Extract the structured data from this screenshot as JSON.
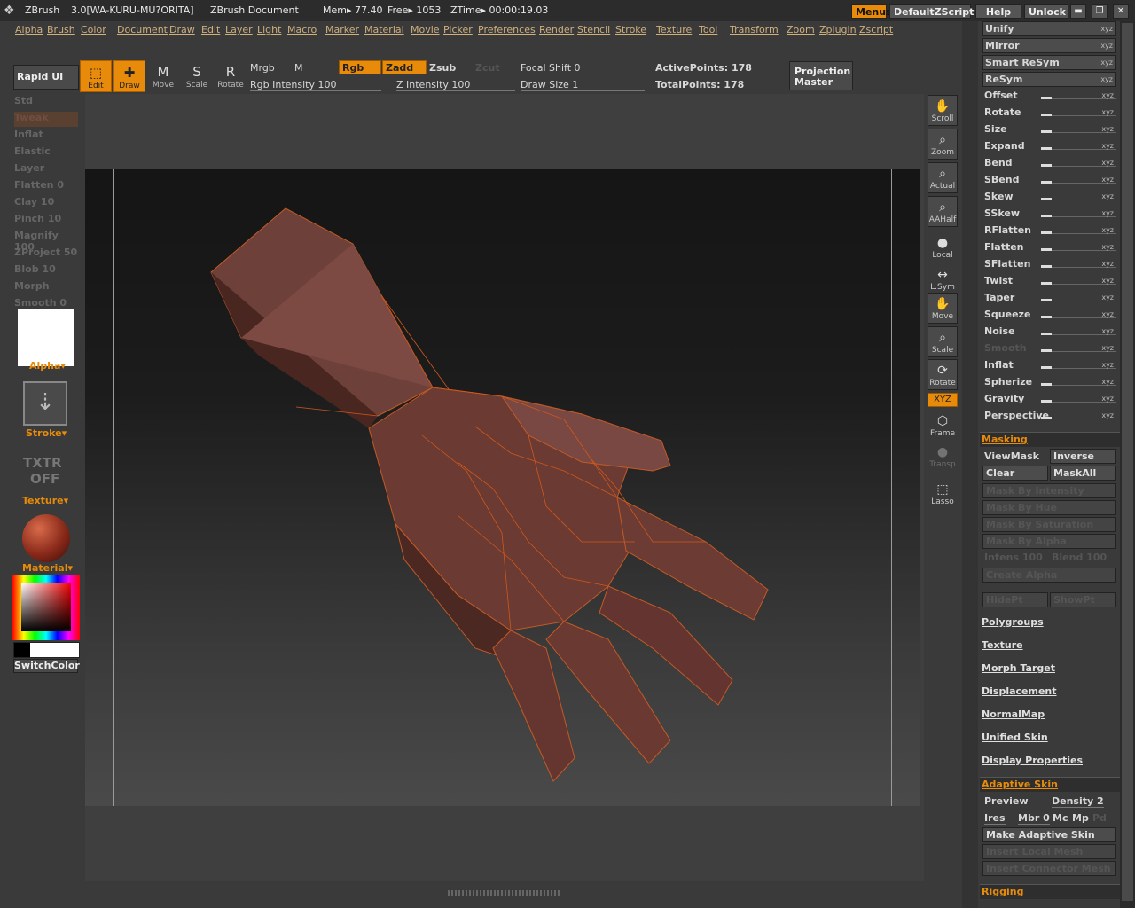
{
  "titlebar": {
    "app": "ZBrush",
    "version": "3.0[WA-KURU-MU?ORITA]",
    "document": "ZBrush Document",
    "mem": "Mem▸ 77.40",
    "free": "Free▸ 1053",
    "ztime": "ZTime▸ 00:00:19.03",
    "menus_btn": "Menus",
    "script_btn": "DefaultZScript",
    "help_btn": "Help",
    "unlock_btn": "Unlock"
  },
  "menubar": [
    "Alpha",
    "Brush",
    "Color",
    "Document",
    "Draw",
    "Edit",
    "Layer",
    "Light",
    "Macro",
    "Marker",
    "Material",
    "Movie",
    "Picker",
    "Preferences",
    "Render",
    "Stencil",
    "Stroke",
    "Texture",
    "Tool",
    "Transform",
    "Zoom",
    "Zplugin",
    "Zscript"
  ],
  "shelf": {
    "rapid_ui": "Rapid UI",
    "tools": [
      {
        "label": "Edit",
        "icon": "edit-icon",
        "glyph": "⬚",
        "active": true
      },
      {
        "label": "Draw",
        "icon": "draw-icon",
        "glyph": "✚",
        "active": true
      },
      {
        "label": "Move",
        "icon": "move-icon",
        "glyph": "M",
        "active": false
      },
      {
        "label": "Scale",
        "icon": "scale-icon",
        "glyph": "S",
        "active": false
      },
      {
        "label": "Rotate",
        "icon": "rotate-icon",
        "glyph": "R",
        "active": false
      }
    ],
    "mrgb": "Mrgb",
    "m": "M",
    "rgb": "Rgb",
    "zadd": "Zadd",
    "zsub": "Zsub",
    "zcut": "Zcut",
    "rgb_intensity": "Rgb  Intensity 100",
    "z_intensity": "Z  Intensity 100",
    "focal_shift": "Focal  Shift 0",
    "draw_size": "Draw  Size 1",
    "active_points": "ActivePoints: 178",
    "total_points": "TotalPoints: 178",
    "projection_master": [
      "Projection",
      "Master"
    ]
  },
  "left_tray": {
    "brushes": [
      {
        "label": "Std",
        "active": false
      },
      {
        "label": "Tweak",
        "active": true
      },
      {
        "label": "Inflat",
        "active": false
      },
      {
        "label": "Elastic",
        "active": false
      },
      {
        "label": "Layer",
        "active": false
      },
      {
        "label": "Flatten 0",
        "active": false
      },
      {
        "label": "Clay 10",
        "active": false
      },
      {
        "label": "Pinch 10",
        "active": false
      },
      {
        "label": "Magnify 100",
        "active": false
      },
      {
        "label": "ZProject 50",
        "active": false
      },
      {
        "label": "Blob 10",
        "active": false
      },
      {
        "label": "Morph",
        "active": false
      },
      {
        "label": "Smooth 0",
        "active": false
      }
    ],
    "alpha": "Alpha▾",
    "stroke": "Stroke▾",
    "texture_off": [
      "TXTR",
      "OFF"
    ],
    "texture": "Texture▾",
    "material": "Material▾",
    "switch_color": "SwitchColor"
  },
  "right_tools": [
    {
      "label": "Scroll",
      "icon": "scroll-hand-icon",
      "glyph": "✋"
    },
    {
      "label": "Zoom",
      "icon": "zoom-icon",
      "glyph": "⌕"
    },
    {
      "label": "Actual",
      "icon": "actual-icon",
      "glyph": "⌕"
    },
    {
      "label": "AAHalf",
      "icon": "aahalf-icon",
      "glyph": "⌕"
    },
    {
      "label": "Local",
      "icon": "local-icon",
      "glyph": "●"
    },
    {
      "label": "L.Sym",
      "icon": "lsym-icon",
      "glyph": "↔"
    },
    {
      "label": "Move",
      "icon": "move-hand-icon",
      "glyph": "✋"
    },
    {
      "label": "Scale",
      "icon": "scale-zoom-icon",
      "glyph": "⌕"
    },
    {
      "label": "Rotate",
      "icon": "rotate-icon",
      "glyph": "⟳"
    },
    {
      "label": "XYZ",
      "icon": "xyz-icon",
      "glyph": ""
    },
    {
      "label": "Frame",
      "icon": "frame-icon",
      "glyph": "⬡"
    },
    {
      "label": "Transp",
      "icon": "transp-icon",
      "glyph": "●"
    },
    {
      "label": "Lasso",
      "icon": "lasso-icon",
      "glyph": "⬚"
    }
  ],
  "deformation": {
    "unify": "Unify",
    "mirror": "Mirror",
    "smart_resym": "Smart ReSym",
    "resym": "ReSym",
    "sliders": [
      {
        "label": "Offset",
        "axes": "xyz",
        "dim": false
      },
      {
        "label": "Rotate",
        "axes": "xyz",
        "dim": false
      },
      {
        "label": "Size",
        "axes": "xyz",
        "dim": false
      },
      {
        "label": "Expand",
        "axes": "xyz",
        "dim": false
      },
      {
        "label": "Bend",
        "axes": "xyz",
        "dim": false
      },
      {
        "label": "SBend",
        "axes": "xyz",
        "dim": false
      },
      {
        "label": "Skew",
        "axes": "xyz",
        "dim": false
      },
      {
        "label": "SSkew",
        "axes": "xyz",
        "dim": false
      },
      {
        "label": "RFlatten",
        "axes": "xyz",
        "dim": false
      },
      {
        "label": "Flatten",
        "axes": "xyz",
        "dim": false
      },
      {
        "label": "SFlatten",
        "axes": "xyz",
        "dim": false
      },
      {
        "label": "Twist",
        "axes": "xyz",
        "dim": false
      },
      {
        "label": "Taper",
        "axes": "xyz",
        "dim": false
      },
      {
        "label": "Squeeze",
        "axes": "xyz",
        "dim": false
      },
      {
        "label": "Noise",
        "axes": "xyz",
        "dim": false
      },
      {
        "label": "Smooth",
        "axes": "xyz",
        "dim": true
      },
      {
        "label": "Inflat",
        "axes": "xyz",
        "dim": false
      },
      {
        "label": "Spherize",
        "axes": "xyz",
        "dim": false
      },
      {
        "label": "Gravity",
        "axes": "xyz",
        "dim": false
      },
      {
        "label": "Perspective",
        "axes": "xyz",
        "dim": false
      }
    ]
  },
  "masking": {
    "header": "Masking",
    "viewmask": "ViewMask",
    "inverse": "Inverse",
    "clear": "Clear",
    "maskall": "MaskAll",
    "by_intensity": "Mask  By  Intensity",
    "by_hue": "Mask  By  Hue",
    "by_saturation": "Mask  By  Saturation",
    "by_alpha": "Mask  By  Alpha",
    "intens": "Intens 100",
    "blend": "Blend 100",
    "create_alpha": "Create  Alpha",
    "hidept": "HidePt",
    "showpt": "ShowPt"
  },
  "subpalettes": [
    "Polygroups",
    "Texture",
    "Morph  Target",
    "Displacement",
    "NormalMap",
    "Unified  Skin",
    "Display  Properties"
  ],
  "adaptive_skin": {
    "header": "Adaptive  Skin",
    "preview": "Preview",
    "density": "Density 2",
    "ires": "Ires",
    "mbr": "Mbr 0",
    "mc": "Mc",
    "mp": "Mp",
    "pd": "Pd",
    "make": "Make  Adaptive  Skin",
    "insert_local": "Insert  Local  Mesh",
    "insert_connector": "Insert  Connector  Mesh"
  },
  "rigging": "Rigging",
  "colors": {
    "accent": "#e88b0a",
    "mesh": "#6b3a32",
    "wire": "#d0581a"
  }
}
